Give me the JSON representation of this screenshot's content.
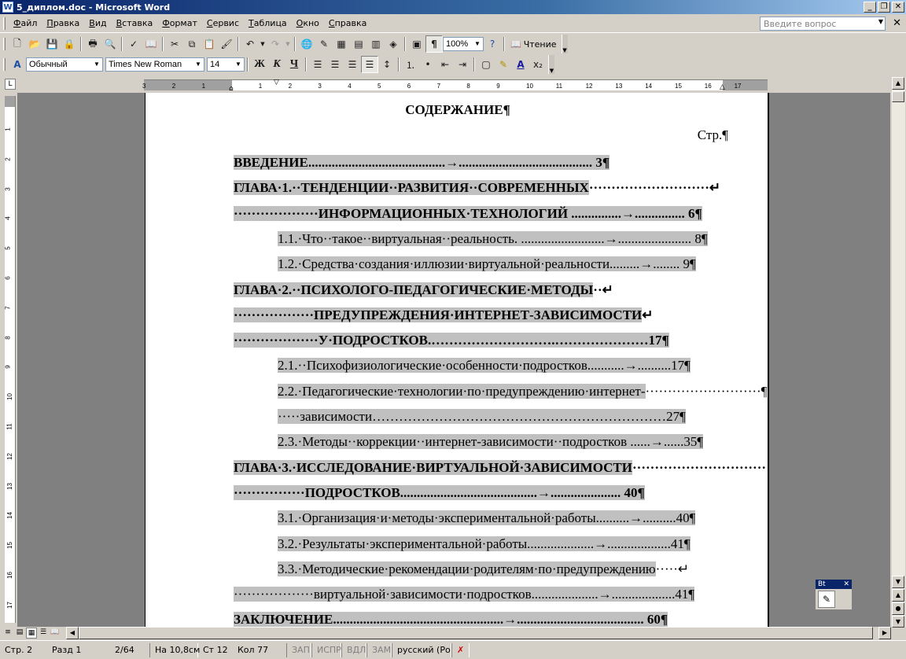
{
  "window": {
    "title": "5_диплом.doc - Microsoft Word",
    "app_icon": "W",
    "minimize": "_",
    "maximize": "❐",
    "close": "✕"
  },
  "menu": {
    "items": [
      "Файл",
      "Правка",
      "Вид",
      "Вставка",
      "Формат",
      "Сервис",
      "Таблица",
      "Окно",
      "Справка"
    ],
    "help_placeholder": "Введите вопрос",
    "doc_close": "✕"
  },
  "toolbar_standard": {
    "zoom": "100%",
    "read_label": "Чтение"
  },
  "toolbar_format": {
    "style": "Обычный",
    "font": "Times New Roman",
    "size": "14",
    "bold": "Ж",
    "italic": "К",
    "underline": "Ч"
  },
  "ruler": {
    "h_ticks": [
      "3",
      "2",
      "1",
      "1",
      "2",
      "3",
      "4",
      "5",
      "6",
      "7",
      "8",
      "9",
      "10",
      "11",
      "12",
      "13",
      "14",
      "15",
      "16",
      "17"
    ],
    "v_ticks": [
      "1",
      "2",
      "3",
      "4",
      "5",
      "6",
      "7",
      "8",
      "9",
      "10",
      "11",
      "12",
      "13",
      "14",
      "15",
      "16",
      "17"
    ],
    "corner": "L"
  },
  "document": {
    "title": "СОДЕРЖАНИЕ¶",
    "page_label": "Стр.¶",
    "lines": [
      {
        "text": "ВВЕДЕНИЕ.........................................→........................................ 3¶",
        "bold": true,
        "indent": "main"
      },
      {
        "text": "ГЛАВА·1.··ТЕНДЕНЦИИ··РАЗВИТИЯ··СОВРЕМЕННЫХ",
        "tail": "···························↵",
        "bold": true,
        "indent": "main"
      },
      {
        "text": "···················ИНФОРМАЦИОННЫХ·ТЕХНОЛОГИЙ ...............→............... 6¶",
        "bold": true,
        "indent": "main"
      },
      {
        "text": "1.1.·Что··такое··виртуальная··реальность. .........................→...................... 8¶",
        "bold": false,
        "indent": "sub"
      },
      {
        "text": "1.2.·Средства·создания·иллюзии·виртуальной·реальности.........→........ 9¶",
        "bold": false,
        "indent": "sub"
      },
      {
        "text": "ГЛАВА·2.··ПСИХОЛОГО-ПЕДАГОГИЧЕСКИЕ·МЕТОДЫ",
        "tail": "··↵",
        "bold": true,
        "indent": "main"
      },
      {
        "text": "··················ПРЕДУПРЕЖДЕНИЯ·ИНТЕРНЕТ-ЗАВИСИМОСТИ",
        "tail": "↵",
        "bold": true,
        "indent": "main"
      },
      {
        "text": "···················У·ПОДРОСТКОВ.……………………….…………………17¶",
        "bold": true,
        "indent": "main"
      },
      {
        "text": "2.1.··Психофизиологические·особенности·подростков...........→..........17¶",
        "bold": false,
        "indent": "sub"
      },
      {
        "text": "2.2.·Педагогические·технологии·по·предупреждению·интернет-",
        "tail": "··························¶",
        "bold": false,
        "indent": "sub"
      },
      {
        "text": "·····зависимости…………………………………………………………27¶",
        "bold": false,
        "indent": "sub"
      },
      {
        "text": "2.3.·Методы··коррекции··интернет-зависимости··подростков ......→......35¶",
        "bold": false,
        "indent": "sub"
      },
      {
        "text": "ГЛАВА·3.·ИССЛЕДОВАНИЕ·ВИРТУАЛЬНОЙ·ЗАВИСИМОСТИ",
        "tail": "······························",
        "bold": true,
        "indent": "main"
      },
      {
        "text": "················ПОДРОСТКОВ.........................................→..................... 40¶",
        "bold": true,
        "indent": "main"
      },
      {
        "text": "3.1.·Организация·и·методы·экспериментальной·работы..........→..........40¶",
        "bold": false,
        "indent": "sub"
      },
      {
        "text": "3.2.·Результаты·экспериментальной·работы....................→...................41¶",
        "bold": false,
        "indent": "sub"
      },
      {
        "text": "3.3.·Методические·рекомендации·родителям·по·предупреждению",
        "tail": "·····↵",
        "bold": false,
        "indent": "sub"
      },
      {
        "text": "··················виртуальной·зависимости·подростков....................→...................41¶",
        "bold": false,
        "indent": "main"
      },
      {
        "text": "ЗАКЛЮЧЕНИЕ...................................................→...................................... 60¶",
        "bold": true,
        "indent": "main"
      }
    ]
  },
  "status": {
    "page": "Стр. 2",
    "section": "Разд 1",
    "pages": "2/64",
    "at": "На 10,8см",
    "line": "Ст 12",
    "col": "Кол 77",
    "rec": "ЗАП",
    "trk": "ИСПР",
    "ext": "ВДЛ",
    "ovr": "ЗАМ",
    "lang": "русский (Ро"
  },
  "floating_toolbar": {
    "title": "Вt"
  }
}
